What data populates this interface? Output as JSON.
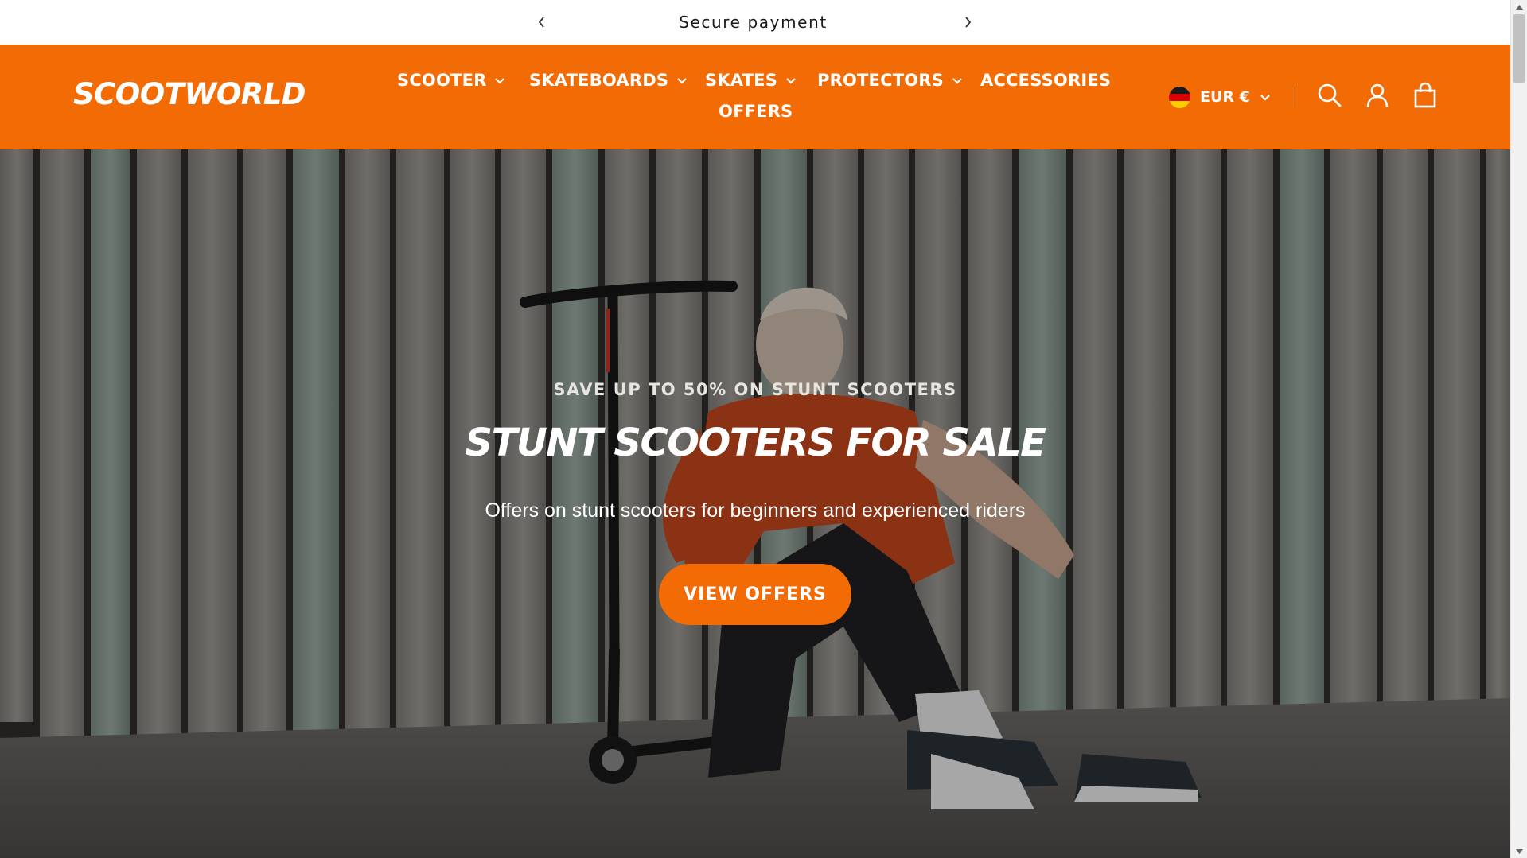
{
  "announcement": {
    "message": "Secure payment",
    "prev_icon": "chevron-left-icon",
    "next_icon": "chevron-right-icon"
  },
  "header": {
    "logo_text": "SCOOTWORLD",
    "background_color": "#f26b05",
    "nav": [
      {
        "label": "SCOOTER",
        "has_dropdown": true
      },
      {
        "label": "SKATEBOARDS",
        "has_dropdown": true
      },
      {
        "label": "SKATES",
        "has_dropdown": true
      },
      {
        "label": "PROTECTORS",
        "has_dropdown": true
      },
      {
        "label": "ACCESSORIES",
        "has_dropdown": false
      },
      {
        "label": "OFFERS",
        "has_dropdown": false
      }
    ],
    "currency": {
      "label": "EUR €",
      "flag": "germany-flag-icon"
    },
    "icons": [
      "search-icon",
      "account-icon",
      "cart-icon"
    ]
  },
  "hero": {
    "kicker": "SAVE UP TO 50% ON STUNT SCOOTERS",
    "title": "STUNT SCOOTERS FOR SALE",
    "subtitle": "Offers on stunt scooters for beginners and experienced riders",
    "cta_label": "VIEW OFFERS",
    "cta_color": "#f26b05"
  }
}
